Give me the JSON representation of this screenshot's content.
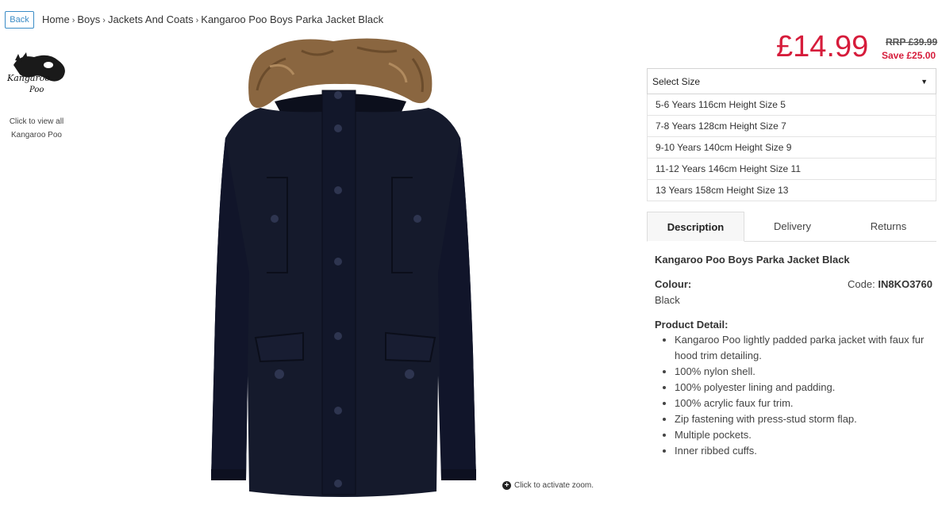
{
  "nav": {
    "back_label": "Back",
    "breadcrumb": [
      "Home",
      "Boys",
      "Jackets And Coats",
      "Kangaroo Poo Boys Parka Jacket Black"
    ]
  },
  "brand": {
    "logo_text_1": "Kangaroo",
    "logo_text_2": "Poo",
    "caption_1": "Click to view all",
    "caption_2": "Kangaroo Poo"
  },
  "image": {
    "zoom_hint": "Click to activate zoom."
  },
  "pricing": {
    "price": "£14.99",
    "rrp": "RRP £39.99",
    "save": "Save £25.00"
  },
  "size": {
    "placeholder": "Select Size",
    "options": [
      "5-6 Years 116cm Height Size 5",
      "7-8 Years 128cm Height Size 7",
      "9-10 Years 140cm Height Size 9",
      "11-12 Years 146cm Height Size 11",
      "13 Years 158cm Height Size 13"
    ]
  },
  "tabs": [
    "Description",
    "Delivery",
    "Returns"
  ],
  "description": {
    "title": "Kangaroo Poo Boys Parka Jacket Black",
    "colour_label": "Colour:",
    "colour_value": "Black",
    "code_label": "Code:",
    "code_value": "IN8KO3760",
    "detail_heading": "Product Detail:",
    "details": [
      "Kangaroo Poo lightly padded parka jacket with faux fur hood trim detailing.",
      "100% nylon shell.",
      "100% polyester lining and padding.",
      "100% acrylic faux fur trim.",
      "Zip fastening with press-stud storm flap.",
      "Multiple pockets.",
      "Inner ribbed cuffs."
    ]
  },
  "colors": {
    "accent_red": "#d61c3b",
    "link_blue": "#3a8cc6",
    "jacket": "#151a2c",
    "fur": "#8a6640"
  }
}
